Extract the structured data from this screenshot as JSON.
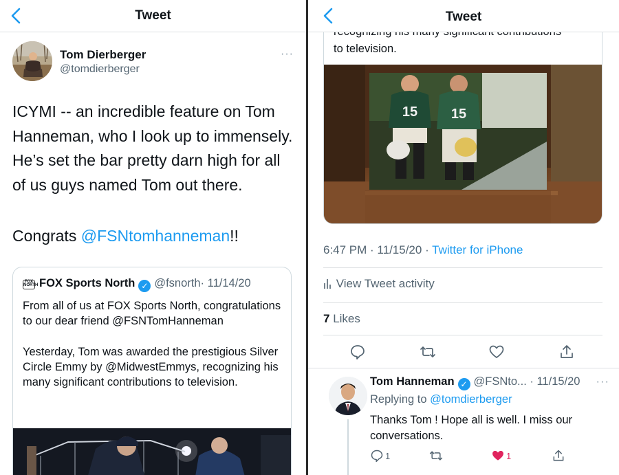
{
  "left": {
    "nav_title": "Tweet",
    "author": {
      "name": "Tom Dierberger",
      "handle": "@tomdierberger"
    },
    "more": "···",
    "tweet_text": "ICYMI -- an incredible feature on Tom Hanneman, who I look up to immensely. He’s set the bar pretty darn high for all of us guys named Tom out there.",
    "congrats_prefix": "Congrats ",
    "congrats_mention": "@FSNtomhanneman",
    "congrats_suffix": "!!",
    "quote": {
      "logo_text": "FOX SPORTS NORTH",
      "name": "FOX Sports North",
      "handle": "@fsnorth",
      "date": "· 11/14/20",
      "text": "From all of us at FOX Sports North, congratulations to our dear friend @FSNTomHanneman\n\nYesterday, Tom was awarded the prestigious Silver Circle Emmy by @MidwestEmmys, recognizing his many significant contributions to television."
    }
  },
  "right": {
    "nav_title": "Tweet",
    "partial_line_1": "recognizing his many significant contributions",
    "partial_line_2": "to television.",
    "photo_numbers": [
      "15",
      "15"
    ],
    "time": "6:47 PM",
    "date": "· 11/15/20 ·",
    "source": "Twitter for iPhone",
    "activity": "View Tweet activity",
    "likes_count": "7",
    "likes_label": "Likes",
    "reply": {
      "name": "Tom Hanneman",
      "handle": "@FSNto...",
      "date": "· 11/15/20",
      "more": "···",
      "replying_prefix": "Replying to ",
      "replying_to": "@tomdierberger",
      "text": "Thanks Tom !  Hope all is well.  I miss our conversations.",
      "reply_count": "1",
      "like_count": "1"
    }
  },
  "colors": {
    "accent": "#1d9bf0",
    "like": "#e0245e",
    "text": "#0f1419",
    "muted": "#536471"
  },
  "icons": [
    "back-chevron-icon",
    "more-icon",
    "verified-icon",
    "reply-icon",
    "retweet-icon",
    "like-icon",
    "share-icon",
    "activity-icon"
  ]
}
